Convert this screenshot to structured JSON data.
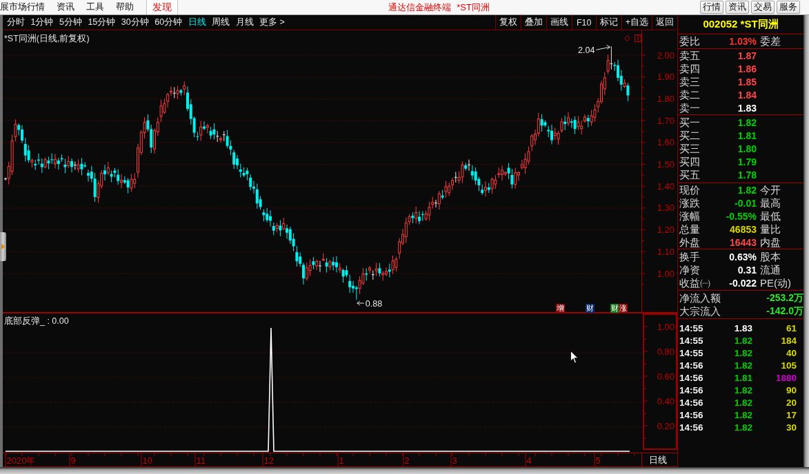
{
  "menu_bar": {
    "items": [
      {
        "label": "展市场行情",
        "kind": "menu"
      },
      {
        "label": "资讯",
        "kind": "menu"
      },
      {
        "label": "工具",
        "kind": "menu"
      },
      {
        "label": "帮助",
        "kind": "menu"
      },
      {
        "label": "发现",
        "kind": "highlight"
      }
    ],
    "title": "通达信金融终端",
    "stock": "*ST同洲",
    "buttons": [
      "行情",
      "资讯",
      "交易",
      "服务"
    ]
  },
  "toolbar": {
    "periods": [
      {
        "label": "分时",
        "selected": false
      },
      {
        "label": "1分钟",
        "selected": false
      },
      {
        "label": "5分钟",
        "selected": false
      },
      {
        "label": "15分钟",
        "selected": false
      },
      {
        "label": "30分钟",
        "selected": false
      },
      {
        "label": "60分钟",
        "selected": false
      },
      {
        "label": "日线",
        "selected": true
      },
      {
        "label": "周线",
        "selected": false
      },
      {
        "label": "月线",
        "selected": false
      }
    ],
    "more": "更多 >",
    "actions": [
      "复权",
      "叠加",
      "画线",
      "F10",
      "标记",
      "+自选",
      "返回"
    ]
  },
  "price_chart": {
    "title": "*ST同洲(日线,前复权)",
    "yticks": [
      "2.00",
      "1.90",
      "1.80",
      "1.70",
      "1.60",
      "1.50",
      "1.40",
      "1.30",
      "1.20",
      "1.10",
      "1.00"
    ],
    "high_label": "2.04",
    "low_label": "0.88",
    "markers": [
      {
        "label": "增",
        "color": "#8c0a0a"
      },
      {
        "label": "财",
        "color": "#0a2a6e"
      },
      {
        "label": "财",
        "color": "#1a7a1a"
      },
      {
        "label": "涨",
        "color": "#8c0a0a"
      }
    ]
  },
  "indicator": {
    "label": "底部反弹_ : 0.00",
    "yticks": [
      "1.00",
      "0.80",
      "0.60",
      "0.40",
      "0.20"
    ]
  },
  "date_axis": {
    "labels": [
      "2020年",
      "9",
      "10",
      "11",
      "12",
      "1",
      "2",
      "3",
      "4",
      "5"
    ],
    "period": "日线"
  },
  "quote": {
    "header": "002052 *ST同洲",
    "ratio": {
      "label": "委比",
      "value": "1.03%",
      "color": "#ff3232",
      "right_label": "委差"
    },
    "asks": [
      {
        "label": "卖五",
        "value": "1.87",
        "color": "#ff4646"
      },
      {
        "label": "卖四",
        "value": "1.86",
        "color": "#ff4646"
      },
      {
        "label": "卖三",
        "value": "1.85",
        "color": "#ff4646"
      },
      {
        "label": "卖二",
        "value": "1.84",
        "color": "#ff4646"
      },
      {
        "label": "卖一",
        "value": "1.83",
        "color": "#ffffff"
      }
    ],
    "bids": [
      {
        "label": "买一",
        "value": "1.82",
        "color": "#00d200"
      },
      {
        "label": "买二",
        "value": "1.81",
        "color": "#00d200"
      },
      {
        "label": "买三",
        "value": "1.80",
        "color": "#00d200"
      },
      {
        "label": "买四",
        "value": "1.79",
        "color": "#00d200"
      },
      {
        "label": "买五",
        "value": "1.78",
        "color": "#00d200"
      }
    ],
    "stats": [
      {
        "label": "现价",
        "value": "1.82",
        "color": "#00d200",
        "right_label": "今开"
      },
      {
        "label": "涨跌",
        "value": "-0.01",
        "color": "#00d200",
        "right_label": "最高"
      },
      {
        "label": "涨幅",
        "value": "-0.55%",
        "color": "#00d200",
        "right_label": "最低"
      },
      {
        "label": "总量",
        "value": "46853",
        "color": "#d8d800",
        "right_label": "量比"
      },
      {
        "label": "外盘",
        "value": "16443",
        "color": "#ff4646",
        "right_label": "内盘"
      }
    ],
    "fundamentals": [
      {
        "label": "换手",
        "value": "0.63%",
        "color": "#ffffff",
        "right_label": "股本"
      },
      {
        "label": "净资",
        "value": "0.31",
        "color": "#ffffff",
        "right_label": "流通"
      },
      {
        "label": "收益㈠",
        "value": "-0.022",
        "color": "#ffffff",
        "right_label": "PE(动)"
      }
    ],
    "flows": [
      {
        "label": "净流入额",
        "value": "-253.2万"
      },
      {
        "label": "大宗流入",
        "value": "-142.0万"
      }
    ],
    "ticks": [
      {
        "time": "14:55",
        "price": {
          "value": "1.83",
          "color": "#ffffff"
        },
        "volume": {
          "value": "61",
          "color": "#d8d800"
        }
      },
      {
        "time": "14:55",
        "price": {
          "value": "1.82",
          "color": "#00d200"
        },
        "volume": {
          "value": "184",
          "color": "#d8d800"
        }
      },
      {
        "time": "14:55",
        "price": {
          "value": "1.82",
          "color": "#00d200"
        },
        "volume": {
          "value": "40",
          "color": "#d8d800"
        }
      },
      {
        "time": "14:56",
        "price": {
          "value": "1.82",
          "color": "#00d200"
        },
        "volume": {
          "value": "105",
          "color": "#d8d800"
        }
      },
      {
        "time": "14:56",
        "price": {
          "value": "1.81",
          "color": "#00d200"
        },
        "volume": {
          "value": "1880",
          "color": "#cc00cc"
        }
      },
      {
        "time": "14:56",
        "price": {
          "value": "1.82",
          "color": "#00d200"
        },
        "volume": {
          "value": "90",
          "color": "#d8d800"
        }
      },
      {
        "time": "14:56",
        "price": {
          "value": "1.82",
          "color": "#00d200"
        },
        "volume": {
          "value": "20",
          "color": "#d8d800"
        }
      },
      {
        "time": "14:56",
        "price": {
          "value": "1.82",
          "color": "#00d200"
        },
        "volume": {
          "value": "17",
          "color": "#d8d800"
        }
      },
      {
        "time": "14:56",
        "price": {
          "value": "1.82",
          "color": "#00d200"
        },
        "volume": {
          "value": "30",
          "color": "#d8d800"
        }
      }
    ]
  }
}
